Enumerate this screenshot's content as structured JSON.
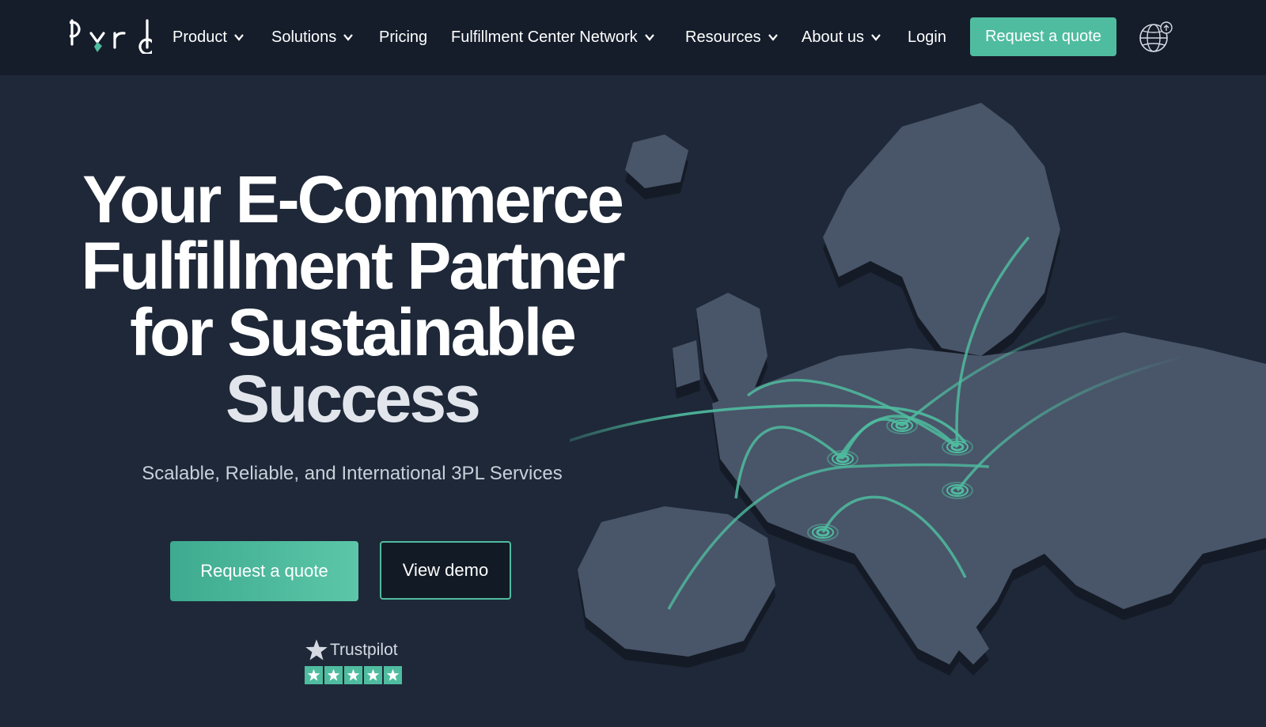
{
  "brand": {
    "logo_text": "byrd",
    "accent_color": "#4fbc9f"
  },
  "nav": {
    "items": [
      {
        "label": "Product",
        "has_dropdown": true
      },
      {
        "label": "Solutions",
        "has_dropdown": true
      },
      {
        "label": "Pricing",
        "has_dropdown": false
      },
      {
        "label": "Fulfillment Center Network",
        "has_dropdown": true
      },
      {
        "label": "Resources",
        "has_dropdown": true
      },
      {
        "label": "About us",
        "has_dropdown": true
      },
      {
        "label": "Login",
        "has_dropdown": false
      }
    ],
    "cta_label": "Request a quote",
    "language_icon": "globe-icon"
  },
  "hero": {
    "title_lines": [
      "Your E-Commerce",
      "Fulfillment Partner",
      "for Sustainable",
      "Success"
    ],
    "subtitle": "Scalable, Reliable, and International 3PL Services",
    "primary_cta": "Request a quote",
    "secondary_cta": "View demo"
  },
  "trustpilot": {
    "name": "Trustpilot",
    "stars": 5
  },
  "map": {
    "image": "europe-network-map",
    "route_color": "#4fbc9f"
  }
}
